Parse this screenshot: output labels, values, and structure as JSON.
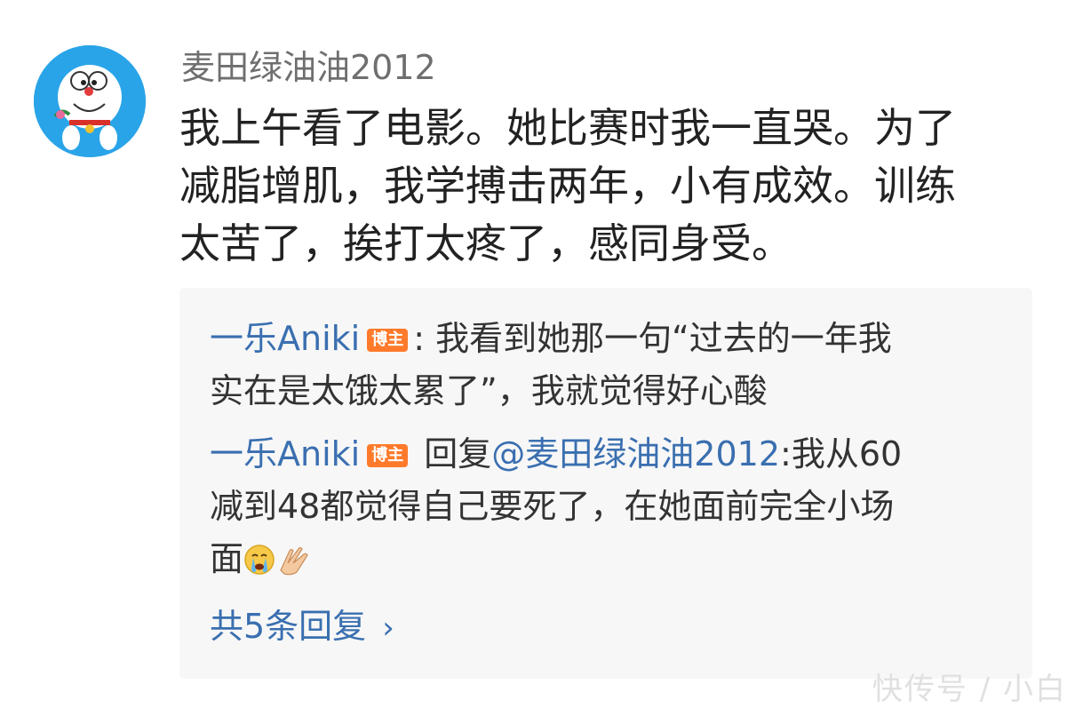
{
  "comment": {
    "username": "麦田绿油油2012",
    "text_lines": [
      "我上午看了电影。她比赛时我一直哭。为了",
      "减脂增肌，我学搏击两年，小有成效。训练",
      "太苦了，挨打太疼了，感同身受。"
    ]
  },
  "replies": [
    {
      "author": "一乐Aniki",
      "badge": "博主",
      "line1_rest": ": 我看到她那一句“过去的一年我",
      "line2": "实在是太饿太累了”，我就觉得好心酸"
    },
    {
      "author": "一乐Aniki",
      "badge": "博主",
      "reply_prefix": " 回复",
      "mention": "@麦田绿油油2012",
      "line1_rest": ":我从60",
      "line2": "减到48都觉得自己要死了，在她面前完全小场",
      "line3": "面",
      "emojis": [
        "crying-face-icon",
        "clapping-hands-icon"
      ]
    }
  ],
  "more_replies_label": "共5条回复",
  "more_replies_chevron": "›",
  "watermark": "快传号 / 小白"
}
